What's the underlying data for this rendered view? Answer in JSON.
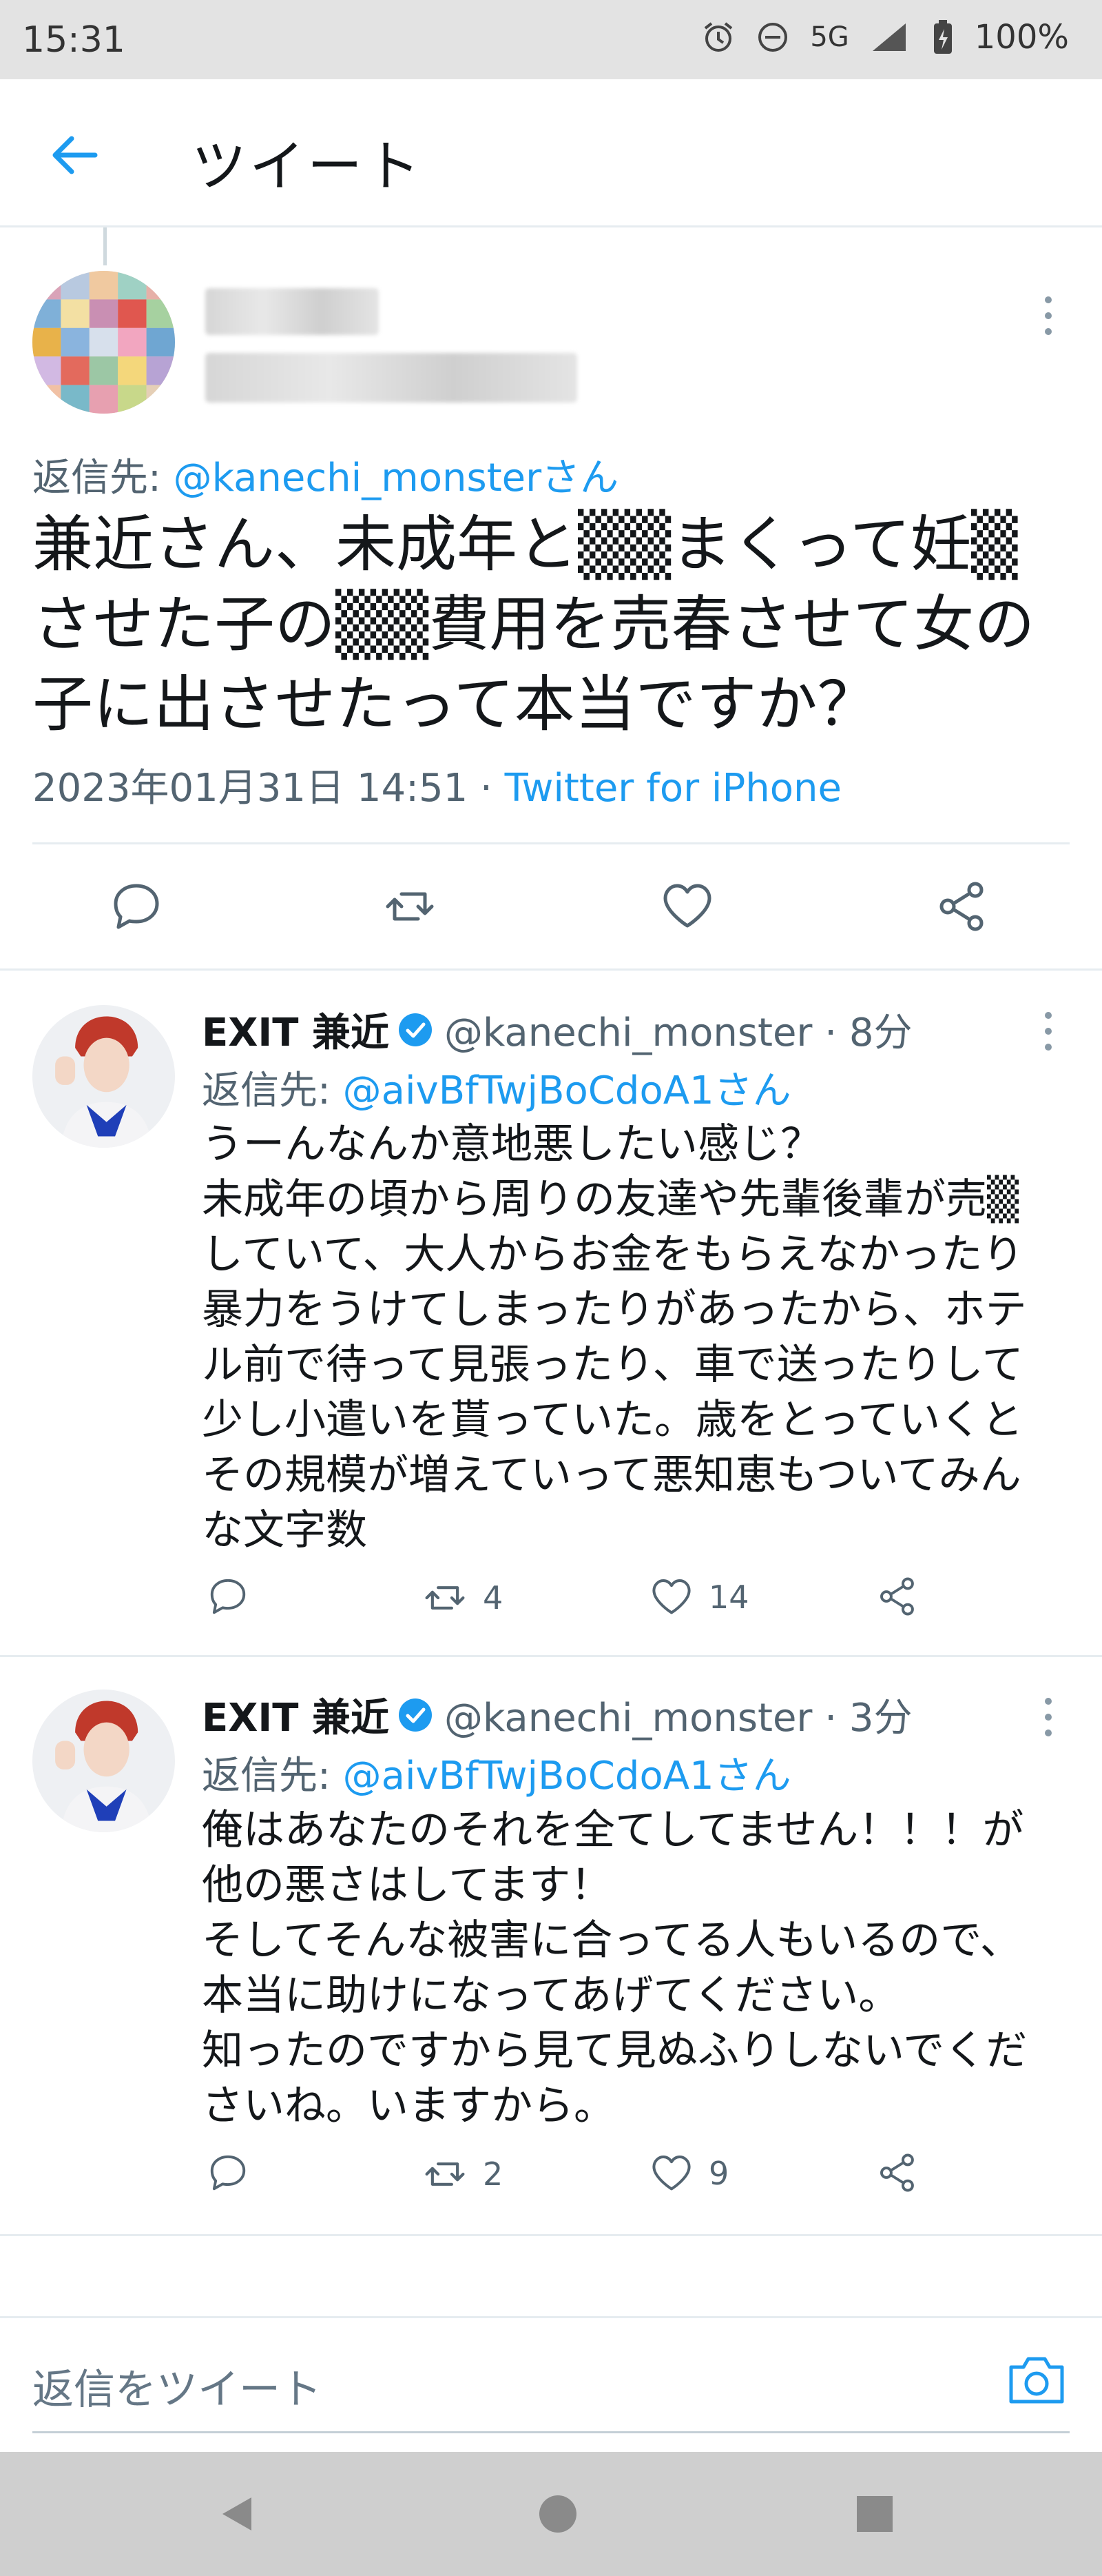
{
  "status": {
    "time": "15:31",
    "network": "5G",
    "battery": "100%"
  },
  "appbar": {
    "title": "ツイート"
  },
  "main_tweet": {
    "reply_prefix": "返信先: ",
    "reply_mention": "@kanechi_monsterさん",
    "text_lines": [
      "兼近さん、未成年と▒▒まくって妊▒",
      "させた子の▒▒費用を売春させて女の",
      "子に出させたって本当ですか？"
    ],
    "date": "2023年01月31日 14:51",
    "separator": " · ",
    "source": "Twitter for iPhone"
  },
  "replies": [
    {
      "name": "EXIT 兼近",
      "handle": "@kanechi_monster · 8分",
      "reply_prefix": "返信先: ",
      "reply_mention": "@aivBfTwjBoCdoA1さん",
      "lines": [
        "うーんなんか意地悪したい感じ？",
        "未成年の頃から周りの友達や先輩後輩が売▒",
        "していて、大人からお金をもらえなかったり",
        "暴力をうけてしまったりがあったから、ホテ",
        "ル前で待って見張ったり、車で送ったりして",
        "少し小遣いを貰っていた。歳をとっていくと",
        "その規模が増えていって悪知恵もついてみん",
        "な文字数"
      ],
      "retweets": "4",
      "likes": "14"
    },
    {
      "name": "EXIT 兼近",
      "handle": "@kanechi_monster · 3分",
      "reply_prefix": "返信先: ",
      "reply_mention": "@aivBfTwjBoCdoA1さん",
      "lines": [
        "俺はあなたのそれを全てしてません！！！が",
        "他の悪さはしてます！",
        "そしてそんな被害に合ってる人もいるので、",
        "本当に助けになってあげてください。",
        "知ったのですから見て見ぬふりしないでくだ",
        "さいね。いますから。"
      ],
      "retweets": "2",
      "likes": "9"
    }
  ],
  "composer": {
    "placeholder": "返信をツイート"
  },
  "colors": {
    "accent": "#1d9bf0",
    "text": "#14171a",
    "secondary": "#536471"
  }
}
